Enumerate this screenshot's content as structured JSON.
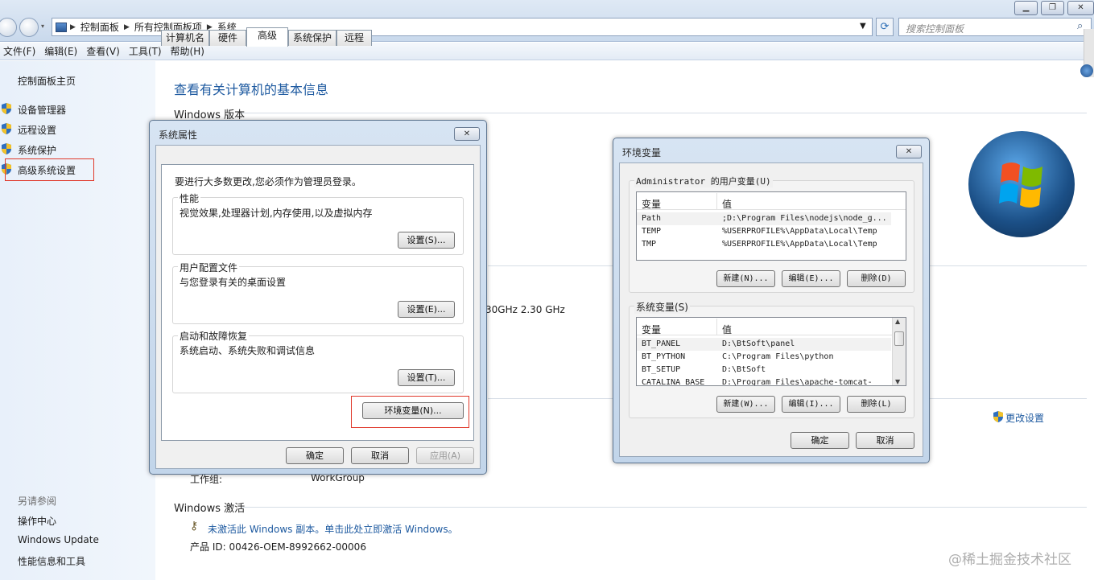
{
  "address": {
    "crumbs": [
      "控制面板",
      "所有控制面板项",
      "系统"
    ]
  },
  "search": {
    "placeholder": "搜索控制面板"
  },
  "menu": [
    "文件(F)",
    "编辑(E)",
    "查看(V)",
    "工具(T)",
    "帮助(H)"
  ],
  "leftnav": {
    "home": "控制面板主页",
    "items": [
      "设备管理器",
      "远程设置",
      "系统保护",
      "高级系统设置"
    ],
    "see_also_title": "另请参阅",
    "see_also": [
      "操作中心",
      "Windows Update",
      "性能信息和工具"
    ]
  },
  "main": {
    "title": "查看有关计算机的基本信息",
    "windows_edition": "Windows 版本",
    "processor_speed": "30GHz   2.30 GHz",
    "change_settings": "更改设置",
    "workgroup_label": "工作组:",
    "workgroup_value": "WorkGroup",
    "activation_title": "Windows 激活",
    "activation_text": "未激活此 Windows 副本。单击此处立即激活 Windows。",
    "product_id": "产品 ID: 00426-OEM-8992662-00006"
  },
  "sysprops": {
    "title": "系统属性",
    "tabs": [
      "计算机名",
      "硬件",
      "高级",
      "系统保护",
      "远程"
    ],
    "admin_note": "要进行大多数更改,您必须作为管理员登录。",
    "perf_label": "性能",
    "perf_text": "视觉效果,处理器计划,内存使用,以及虚拟内存",
    "perf_btn": "设置(S)...",
    "profile_label": "用户配置文件",
    "profile_text": "与您登录有关的桌面设置",
    "profile_btn": "设置(E)...",
    "startup_label": "启动和故障恢复",
    "startup_text": "系统启动、系统失败和调试信息",
    "startup_btn": "设置(T)...",
    "env_btn": "环境变量(N)...",
    "ok": "确定",
    "cancel": "取消",
    "apply": "应用(A)"
  },
  "envvars": {
    "title": "环境变量",
    "user_group": "Administrator 的用户变量(U)",
    "col_var": "变量",
    "col_val": "值",
    "user_rows": [
      {
        "name": "Path",
        "value": ";D:\\Program Files\\nodejs\\node_g..."
      },
      {
        "name": "TEMP",
        "value": "%USERPROFILE%\\AppData\\Local\\Temp"
      },
      {
        "name": "TMP",
        "value": "%USERPROFILE%\\AppData\\Local\\Temp"
      }
    ],
    "user_new": "新建(N)...",
    "user_edit": "编辑(E)...",
    "user_delete": "删除(D)",
    "sys_group": "系统变量(S)",
    "sys_rows": [
      {
        "name": "BT_PANEL",
        "value": "D:\\BtSoft\\panel"
      },
      {
        "name": "BT_PYTHON",
        "value": "C:\\Program Files\\python"
      },
      {
        "name": "BT_SETUP",
        "value": "D:\\BtSoft"
      },
      {
        "name": "CATALINA_BASE",
        "value": "D:\\Program Files\\apache-tomcat-"
      }
    ],
    "sys_new": "新建(W)...",
    "sys_edit": "编辑(I)...",
    "sys_delete": "删除(L)",
    "ok": "确定",
    "cancel": "取消"
  },
  "watermark": "@稀土掘金技术社区"
}
